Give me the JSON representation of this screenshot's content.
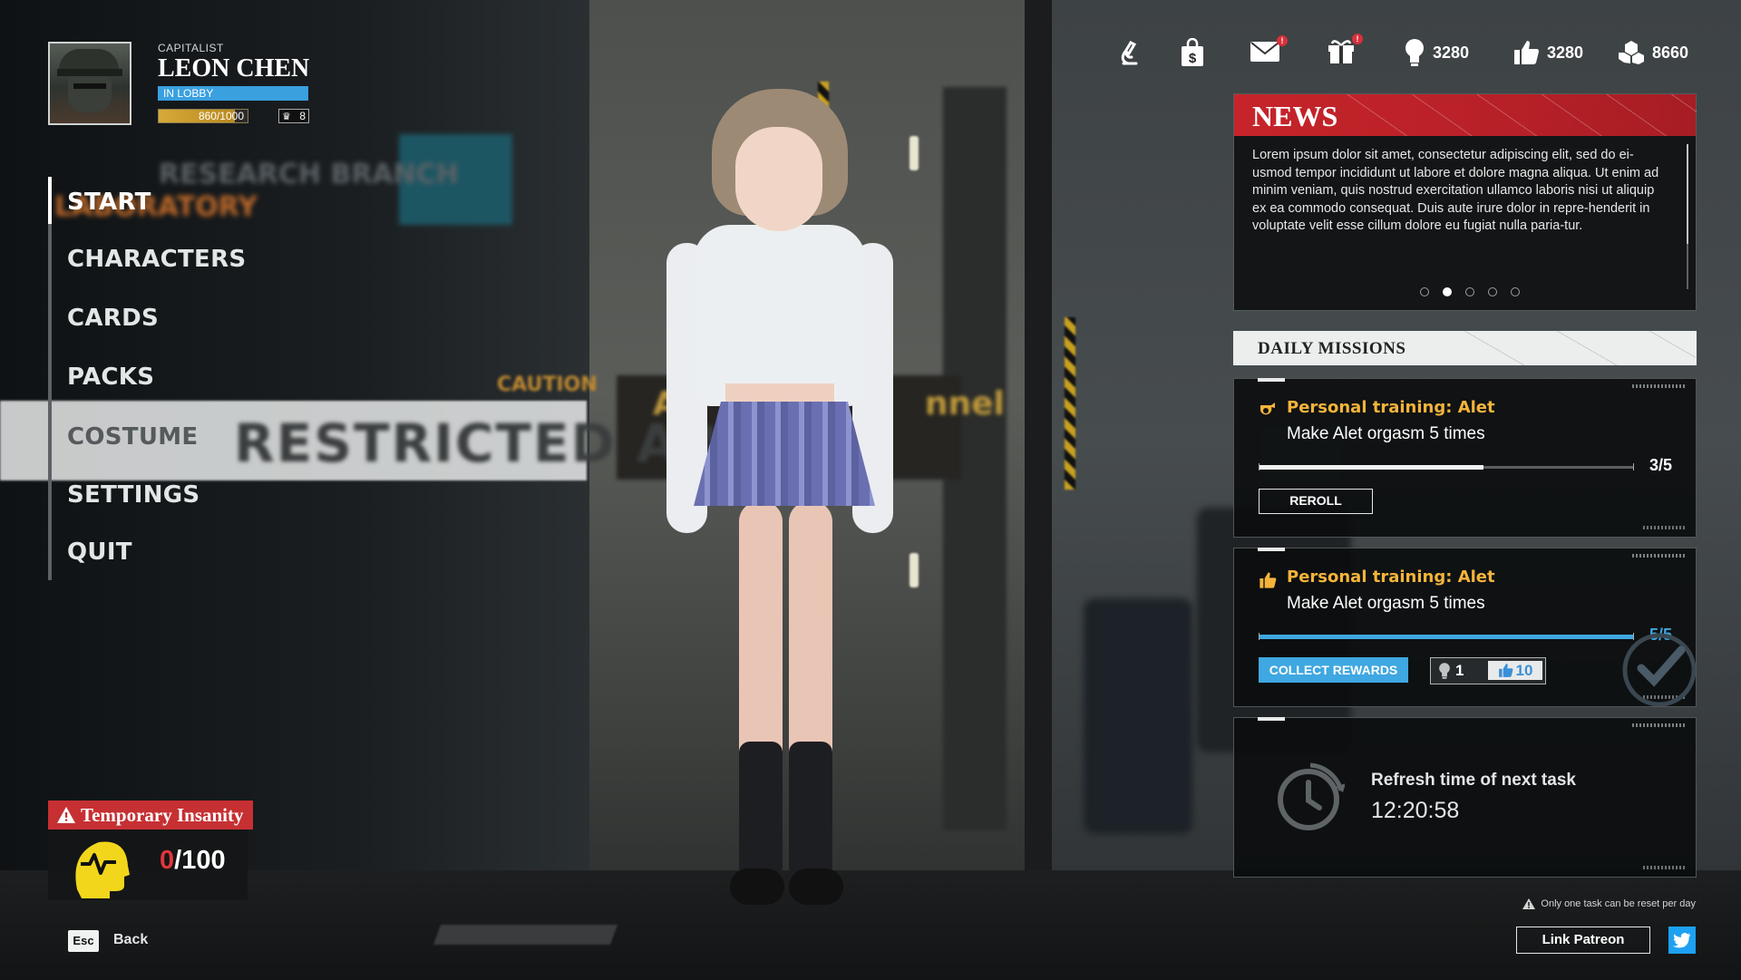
{
  "player": {
    "role": "CAPITALIST",
    "name": "LEON CHEN",
    "status": "IN LOBBY",
    "xp_text": "860/1000",
    "xp_fraction": 0.86,
    "level": "8"
  },
  "menu": {
    "items": [
      {
        "label": "START"
      },
      {
        "label": "CHARACTERS"
      },
      {
        "label": "CARDS"
      },
      {
        "label": "PACKS"
      },
      {
        "label": "COSTUME"
      },
      {
        "label": "SETTINGS"
      },
      {
        "label": "QUIT"
      }
    ],
    "active_index": 0
  },
  "resources": {
    "bulbs": "3280",
    "likes": "3280",
    "gems": "8660"
  },
  "top_icons": [
    "research-icon",
    "shop-bag-icon",
    "mail-icon",
    "gift-icon"
  ],
  "news": {
    "title": "NEWS",
    "body": "Lorem ipsum dolor sit amet, consectetur adipiscing elit, sed do ei-usmod tempor incididunt ut labore et dolore magna aliqua. Ut enim ad minim veniam, quis nostrud exercitation ullamco laboris nisi ut aliquip ex ea commodo consequat. Duis aute irure dolor in repre-henderit in voluptate velit esse cillum dolore eu fugiat nulla paria-tur.",
    "pages": 5,
    "current_page": 2
  },
  "missions": {
    "title": "DAILY MISSIONS",
    "list": [
      {
        "title": "Personal training: Alet",
        "description": "Make Alet orgasm 5 times",
        "progress_text": "3/5",
        "progress": 0.6,
        "button": "REROLL",
        "icon": "whistle-icon"
      },
      {
        "title": "Personal training: Alet",
        "description": "Make Alet orgasm 5 times",
        "progress_text": "5/5",
        "progress": 1.0,
        "button": "COLLECT REWARDS",
        "icon": "thumbs-up-icon",
        "reward_bulbs": "1",
        "reward_likes": "10"
      }
    ],
    "refresh_label": "Refresh time of next task",
    "refresh_time": "12:20:58",
    "note": "Only one task can be reset per day"
  },
  "insanity": {
    "label": "Temporary Insanity",
    "current": "0",
    "max": "/100"
  },
  "footer": {
    "esc_key": "Esc",
    "back_label": "Back",
    "patreon_label": "Link Patreon"
  },
  "colors": {
    "accent_blue": "#3fa7e1",
    "news_red": "#c6242a",
    "mission_gold": "#f4b43a",
    "insanity_red": "#e0353c",
    "xp_gold": "#d6a93a"
  }
}
